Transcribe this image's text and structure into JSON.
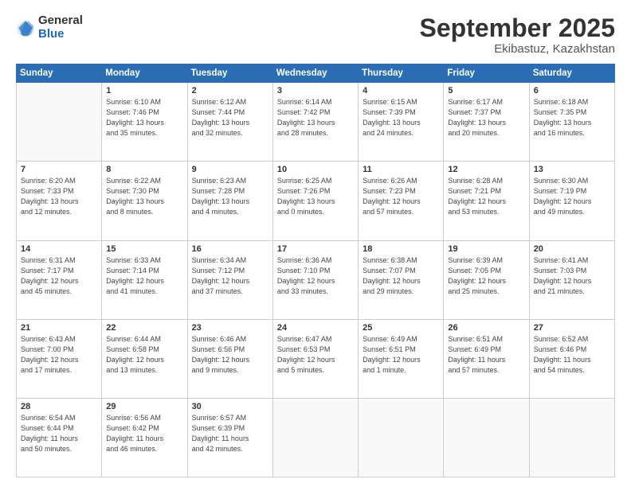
{
  "header": {
    "logo": {
      "general": "General",
      "blue": "Blue"
    },
    "title": "September 2025",
    "location": "Ekibastuz, Kazakhstan"
  },
  "weekdays": [
    "Sunday",
    "Monday",
    "Tuesday",
    "Wednesday",
    "Thursday",
    "Friday",
    "Saturday"
  ],
  "weeks": [
    [
      {
        "day": "",
        "info": ""
      },
      {
        "day": "1",
        "info": "Sunrise: 6:10 AM\nSunset: 7:46 PM\nDaylight: 13 hours\nand 35 minutes."
      },
      {
        "day": "2",
        "info": "Sunrise: 6:12 AM\nSunset: 7:44 PM\nDaylight: 13 hours\nand 32 minutes."
      },
      {
        "day": "3",
        "info": "Sunrise: 6:14 AM\nSunset: 7:42 PM\nDaylight: 13 hours\nand 28 minutes."
      },
      {
        "day": "4",
        "info": "Sunrise: 6:15 AM\nSunset: 7:39 PM\nDaylight: 13 hours\nand 24 minutes."
      },
      {
        "day": "5",
        "info": "Sunrise: 6:17 AM\nSunset: 7:37 PM\nDaylight: 13 hours\nand 20 minutes."
      },
      {
        "day": "6",
        "info": "Sunrise: 6:18 AM\nSunset: 7:35 PM\nDaylight: 13 hours\nand 16 minutes."
      }
    ],
    [
      {
        "day": "7",
        "info": "Sunrise: 6:20 AM\nSunset: 7:33 PM\nDaylight: 13 hours\nand 12 minutes."
      },
      {
        "day": "8",
        "info": "Sunrise: 6:22 AM\nSunset: 7:30 PM\nDaylight: 13 hours\nand 8 minutes."
      },
      {
        "day": "9",
        "info": "Sunrise: 6:23 AM\nSunset: 7:28 PM\nDaylight: 13 hours\nand 4 minutes."
      },
      {
        "day": "10",
        "info": "Sunrise: 6:25 AM\nSunset: 7:26 PM\nDaylight: 13 hours\nand 0 minutes."
      },
      {
        "day": "11",
        "info": "Sunrise: 6:26 AM\nSunset: 7:23 PM\nDaylight: 12 hours\nand 57 minutes."
      },
      {
        "day": "12",
        "info": "Sunrise: 6:28 AM\nSunset: 7:21 PM\nDaylight: 12 hours\nand 53 minutes."
      },
      {
        "day": "13",
        "info": "Sunrise: 6:30 AM\nSunset: 7:19 PM\nDaylight: 12 hours\nand 49 minutes."
      }
    ],
    [
      {
        "day": "14",
        "info": "Sunrise: 6:31 AM\nSunset: 7:17 PM\nDaylight: 12 hours\nand 45 minutes."
      },
      {
        "day": "15",
        "info": "Sunrise: 6:33 AM\nSunset: 7:14 PM\nDaylight: 12 hours\nand 41 minutes."
      },
      {
        "day": "16",
        "info": "Sunrise: 6:34 AM\nSunset: 7:12 PM\nDaylight: 12 hours\nand 37 minutes."
      },
      {
        "day": "17",
        "info": "Sunrise: 6:36 AM\nSunset: 7:10 PM\nDaylight: 12 hours\nand 33 minutes."
      },
      {
        "day": "18",
        "info": "Sunrise: 6:38 AM\nSunset: 7:07 PM\nDaylight: 12 hours\nand 29 minutes."
      },
      {
        "day": "19",
        "info": "Sunrise: 6:39 AM\nSunset: 7:05 PM\nDaylight: 12 hours\nand 25 minutes."
      },
      {
        "day": "20",
        "info": "Sunrise: 6:41 AM\nSunset: 7:03 PM\nDaylight: 12 hours\nand 21 minutes."
      }
    ],
    [
      {
        "day": "21",
        "info": "Sunrise: 6:43 AM\nSunset: 7:00 PM\nDaylight: 12 hours\nand 17 minutes."
      },
      {
        "day": "22",
        "info": "Sunrise: 6:44 AM\nSunset: 6:58 PM\nDaylight: 12 hours\nand 13 minutes."
      },
      {
        "day": "23",
        "info": "Sunrise: 6:46 AM\nSunset: 6:56 PM\nDaylight: 12 hours\nand 9 minutes."
      },
      {
        "day": "24",
        "info": "Sunrise: 6:47 AM\nSunset: 6:53 PM\nDaylight: 12 hours\nand 5 minutes."
      },
      {
        "day": "25",
        "info": "Sunrise: 6:49 AM\nSunset: 6:51 PM\nDaylight: 12 hours\nand 1 minute."
      },
      {
        "day": "26",
        "info": "Sunrise: 6:51 AM\nSunset: 6:49 PM\nDaylight: 11 hours\nand 57 minutes."
      },
      {
        "day": "27",
        "info": "Sunrise: 6:52 AM\nSunset: 6:46 PM\nDaylight: 11 hours\nand 54 minutes."
      }
    ],
    [
      {
        "day": "28",
        "info": "Sunrise: 6:54 AM\nSunset: 6:44 PM\nDaylight: 11 hours\nand 50 minutes."
      },
      {
        "day": "29",
        "info": "Sunrise: 6:56 AM\nSunset: 6:42 PM\nDaylight: 11 hours\nand 46 minutes."
      },
      {
        "day": "30",
        "info": "Sunrise: 6:57 AM\nSunset: 6:39 PM\nDaylight: 11 hours\nand 42 minutes."
      },
      {
        "day": "",
        "info": ""
      },
      {
        "day": "",
        "info": ""
      },
      {
        "day": "",
        "info": ""
      },
      {
        "day": "",
        "info": ""
      }
    ]
  ]
}
